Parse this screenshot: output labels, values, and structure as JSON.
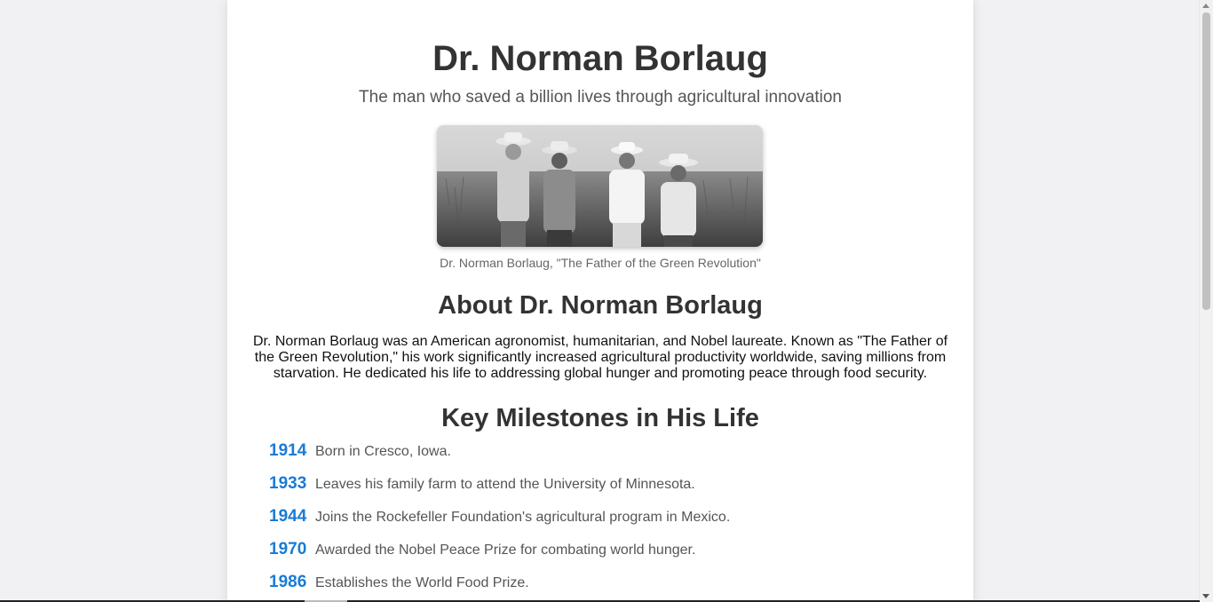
{
  "header": {
    "title": "Dr. Norman Borlaug",
    "subtitle": "The man who saved a billion lives through agricultural innovation"
  },
  "photo": {
    "caption": "Dr. Norman Borlaug, \"The Father of the Green Revolution\""
  },
  "about": {
    "heading": "About Dr. Norman Borlaug",
    "text": "Dr. Norman Borlaug was an American agronomist, humanitarian, and Nobel laureate. Known as \"The Father of the Green Revolution,\" his work significantly increased agricultural productivity worldwide, saving millions from starvation. He dedicated his life to addressing global hunger and promoting peace through food security."
  },
  "milestones": {
    "heading": "Key Milestones in His Life",
    "items": [
      {
        "year": "1914",
        "desc": "Born in Cresco, Iowa."
      },
      {
        "year": "1933",
        "desc": "Leaves his family farm to attend the University of Minnesota."
      },
      {
        "year": "1944",
        "desc": "Joins the Rockefeller Foundation's agricultural program in Mexico."
      },
      {
        "year": "1970",
        "desc": "Awarded the Nobel Peace Prize for combating world hunger."
      },
      {
        "year": "1986",
        "desc": "Establishes the World Food Prize."
      }
    ]
  },
  "colors": {
    "accent": "#1a7bd6",
    "heading": "#333333",
    "page_bg": "#f1f1f4"
  }
}
